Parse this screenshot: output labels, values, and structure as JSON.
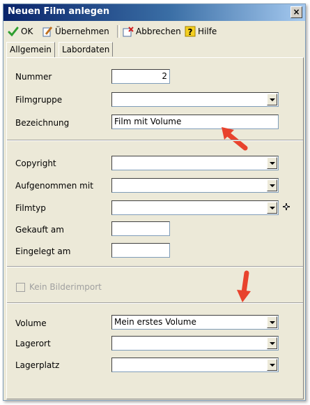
{
  "window": {
    "title": "Neuen Film anlegen",
    "close_label": "×"
  },
  "toolbar": {
    "ok_label": "OK",
    "apply_label": "Übernehmen",
    "cancel_label": "Abbrechen",
    "help_label": "Hilfe",
    "help_icon_glyph": "?"
  },
  "tabs": [
    {
      "label": "Allgemein",
      "active": true
    },
    {
      "label": "Labordaten",
      "active": false
    }
  ],
  "form": {
    "nummer": {
      "label": "Nummer",
      "value": "2"
    },
    "filmgruppe": {
      "label": "Filmgruppe",
      "value": ""
    },
    "bezeichnung": {
      "label": "Bezeichnung",
      "value": "Film mit Volume"
    },
    "copyright": {
      "label": "Copyright",
      "value": ""
    },
    "aufgenommen_mit": {
      "label": "Aufgenommen mit",
      "value": ""
    },
    "filmtyp": {
      "label": "Filmtyp",
      "value": ""
    },
    "gekauft_am": {
      "label": "Gekauft am",
      "value": ""
    },
    "eingelegt_am": {
      "label": "Eingelegt am",
      "value": ""
    },
    "kein_bilderimport": {
      "label": "Kein Bilderimport",
      "checked": false,
      "enabled": false
    },
    "volume": {
      "label": "Volume",
      "value": "Mein erstes Volume"
    },
    "lagerort": {
      "label": "Lagerort",
      "value": ""
    },
    "lagerplatz": {
      "label": "Lagerplatz",
      "value": ""
    }
  },
  "colors": {
    "accent_arrow": "#e8432d",
    "ok_check": "#2e9e2e",
    "title_bar": "#0a246a"
  }
}
